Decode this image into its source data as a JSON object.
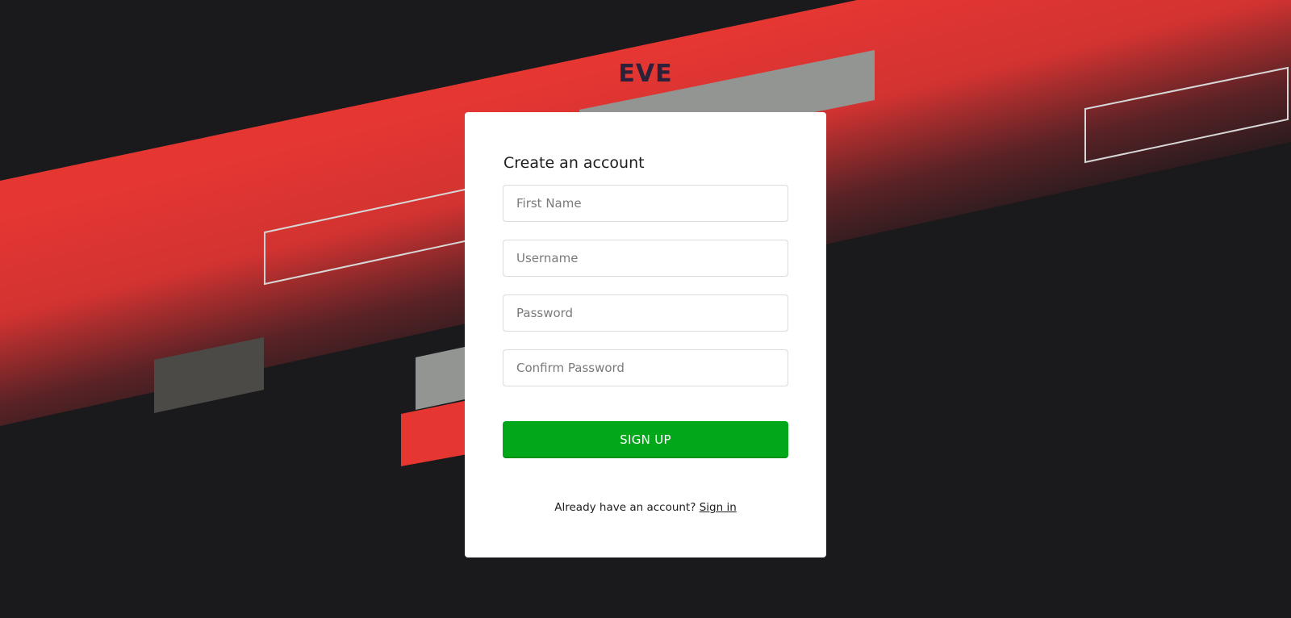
{
  "brand": {
    "name": "EVE"
  },
  "signup_form": {
    "title": "Create an account",
    "first_name": {
      "placeholder": "First Name",
      "value": ""
    },
    "username": {
      "placeholder": "Username",
      "value": ""
    },
    "password": {
      "placeholder": "Password",
      "value": ""
    },
    "confirm_password": {
      "placeholder": "Confirm Password",
      "value": ""
    },
    "submit_label": "SIGN UP",
    "signin_prompt": "Already have an account?",
    "signin_link": "Sign in"
  },
  "colors": {
    "background": "#1a191b",
    "accent_red": "#e53632",
    "accent_gray": "#939593",
    "accent_dark_gray": "#4b4a47",
    "button_green": "#03a81a",
    "brand_text": "#2b2138"
  }
}
